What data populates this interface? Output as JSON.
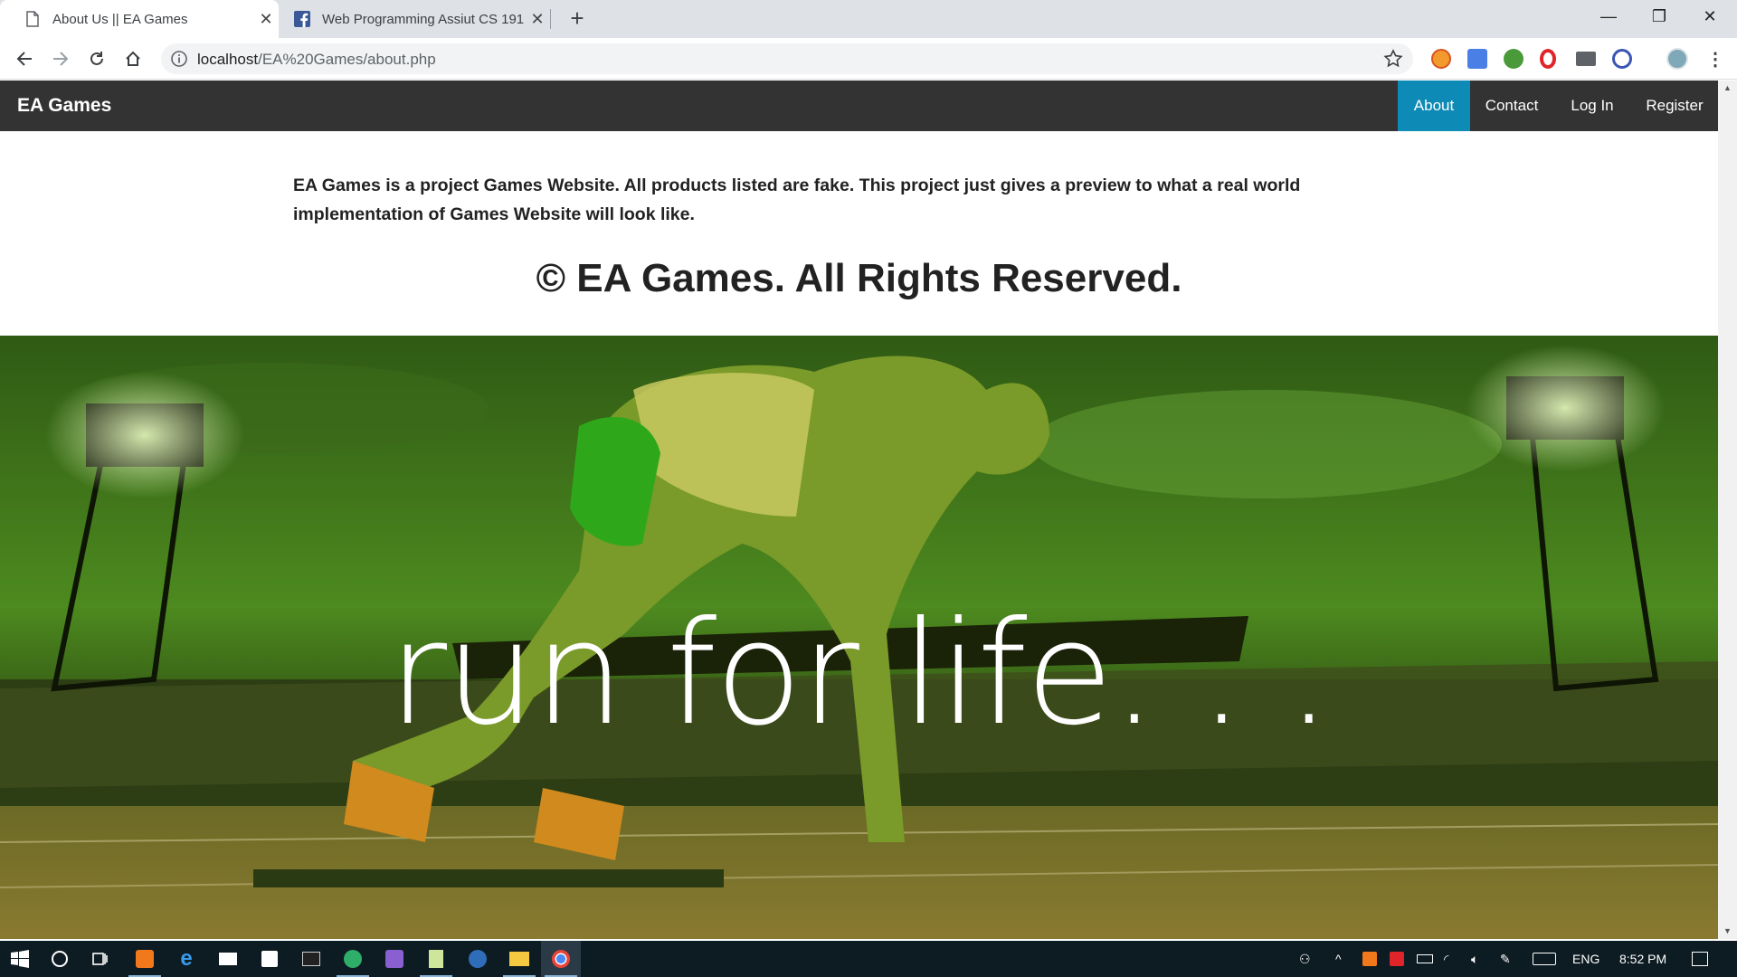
{
  "browser": {
    "tabs": [
      {
        "title": "About Us || EA Games",
        "active": true,
        "favicon": "page-icon"
      },
      {
        "title": "Web Programming Assiut CS 191",
        "active": false,
        "favicon": "facebook-icon"
      }
    ],
    "address": {
      "host": "localhost",
      "path": "/EA%20Games/about.php"
    },
    "extensions": [
      "orange-extension-icon",
      "google-translate-icon",
      "green-extension-icon",
      "opera-icon",
      "mail-icon",
      "block-icon"
    ]
  },
  "site": {
    "brand": "EA Games",
    "nav": [
      {
        "label": "About",
        "active": true
      },
      {
        "label": "Contact",
        "active": false
      },
      {
        "label": "Log In",
        "active": false
      },
      {
        "label": "Register",
        "active": false
      }
    ],
    "about_text": "EA Games is a project Games Website. All products listed are fake. This project just gives a preview to what a real world implementation of Games Website will look like.",
    "copyright": "© EA Games. All Rights Reserved.",
    "hero_text": "run for life. . .",
    "colors": {
      "nav_bg": "#333333",
      "active_nav": "#0e8ab6",
      "hero_tint": "#5aa020"
    }
  },
  "taskbar": {
    "language": "ENG",
    "time": "8:52 PM"
  }
}
